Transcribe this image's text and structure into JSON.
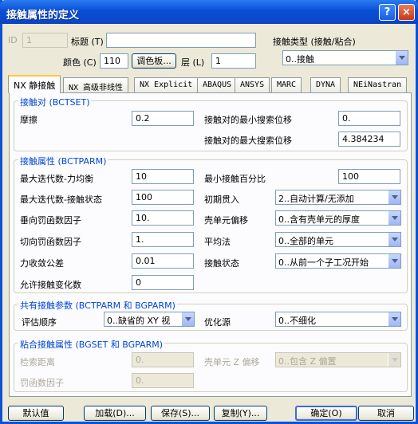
{
  "window": {
    "title": "接触属性的定义",
    "help": "?",
    "close": "×"
  },
  "header": {
    "id_label": "ID",
    "id_value": "1",
    "title_label": "标题 (T)",
    "title_value": "",
    "contact_type_label": "接触类型 (接触/粘合)",
    "contact_type_value": "0..接触",
    "color_label": "颜色 (C)",
    "color_value": "110",
    "palette_button": "调色板...",
    "layer_label": "层 (L)",
    "layer_value": "1"
  },
  "tabs": [
    "NX 静接触",
    "NX 高级非线性",
    "NX Explicit",
    "ABAQUS",
    "ANSYS",
    "MARC",
    "DYNA",
    "NEiNastran"
  ],
  "contact_pair": {
    "group_title": "接触对  (BCTSET)",
    "friction_label": "摩擦",
    "friction_value": "0.2",
    "min_search_label": "接触对的最小搜索位移",
    "min_search_value": "0.",
    "max_search_label": "接触对的最大搜索位移",
    "max_search_value": "4.384234"
  },
  "contact_props": {
    "group_title": "接触属性  (BCTPARM)",
    "max_iter_force_label": "最大迭代数-力均衡",
    "max_iter_force_value": "10",
    "min_contact_pct_label": "最小接触百分比",
    "min_contact_pct_value": "100",
    "max_iter_status_label": "最大迭代数-接触状态",
    "max_iter_status_value": "100",
    "init_penetration_label": "初期贯入",
    "init_penetration_value": "2..自动计算/无添加",
    "normal_penalty_label": "垂向罚函数因子",
    "normal_penalty_value": "10.",
    "shell_offset_label": "壳单元偏移",
    "shell_offset_value": "0..含有壳单元的厚度",
    "tangent_penalty_label": "切向罚函数因子",
    "tangent_penalty_value": "1.",
    "averaging_label": "平均法",
    "averaging_value": "0..全部的单元",
    "force_tol_label": "力收敛公差",
    "force_tol_value": "0.01",
    "contact_status_label": "接触状态",
    "contact_status_value": "0..从前一个子工况开始",
    "allowed_change_label": "允许接触变化数",
    "allowed_change_value": "0"
  },
  "shared_params": {
    "group_title": "共有接触参数  (BCTPARM 和 BGPARM)",
    "eval_order_label": "评估顺序",
    "eval_order_value": "0..缺省的 XY 视",
    "optimize_label": "优化源",
    "optimize_value": "0..不细化"
  },
  "glue_props": {
    "group_title": "粘合接触属性  (BGSET 和 BGPARM)",
    "search_dist_label": "检索距离",
    "search_dist_value": "0.",
    "shell_z_label": "壳单元 Z 偏移",
    "shell_z_value": "0..包含 Z 偏置",
    "penalty_label": "罚函数因子",
    "penalty_value": "0."
  },
  "footer": {
    "default_button": "默认值",
    "load_button": "加载(D)...",
    "save_button": "保存(S)...",
    "copy_button": "复制(Y)...",
    "ok_button": "确定(O)",
    "cancel_button": "取消"
  }
}
